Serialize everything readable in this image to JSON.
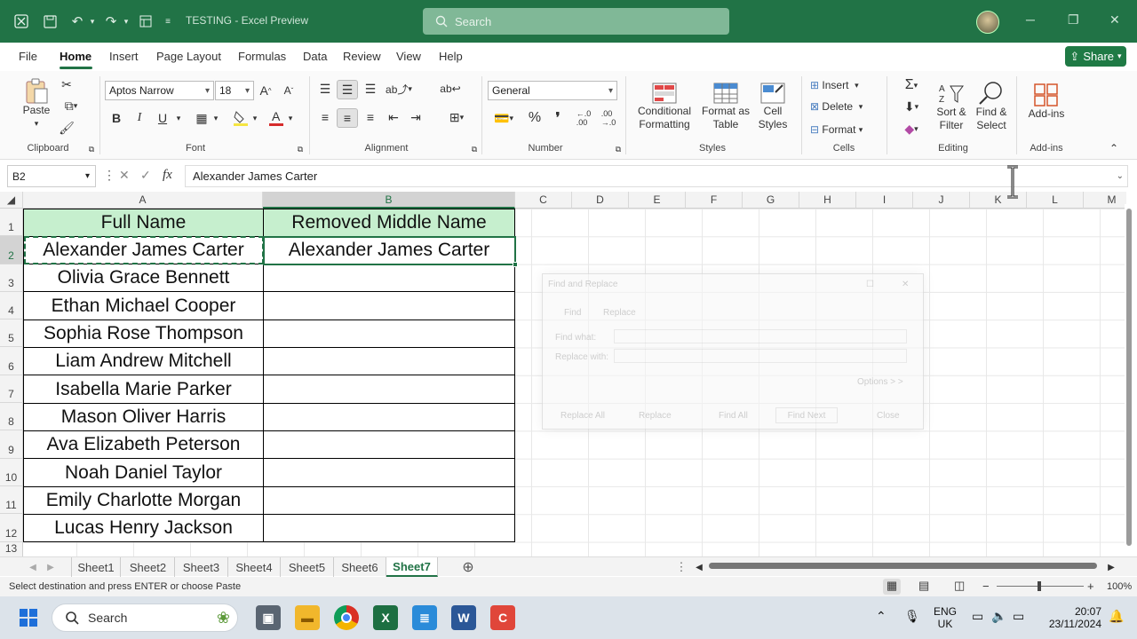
{
  "titlebar": {
    "title": "TESTING  -  Excel Preview",
    "search_placeholder": "Search"
  },
  "menu": {
    "items": [
      "File",
      "Home",
      "Insert",
      "Page Layout",
      "Formulas",
      "Data",
      "Review",
      "View",
      "Help"
    ],
    "active": "Home",
    "share_label": "Share"
  },
  "ribbon": {
    "clipboard": {
      "paste": "Paste",
      "label": "Clipboard"
    },
    "font": {
      "name": "Aptos Narrow",
      "size": "18",
      "label": "Font",
      "bold": "B",
      "italic": "I",
      "underline": "U"
    },
    "alignment": {
      "label": "Alignment"
    },
    "number": {
      "format": "General",
      "label": "Number"
    },
    "styles": {
      "conditional": "Conditional Formatting",
      "format_table": "Format as Table",
      "cell_styles": "Cell Styles",
      "label": "Styles"
    },
    "cells": {
      "insert": "Insert",
      "delete": "Delete",
      "format": "Format",
      "label": "Cells"
    },
    "editing": {
      "sort": "Sort & Filter",
      "find": "Find & Select",
      "label": "Editing"
    },
    "addins": {
      "button": "Add-ins",
      "label": "Add-ins"
    }
  },
  "formula_bar": {
    "name_box": "B2",
    "content": "Alexander James Carter"
  },
  "grid": {
    "columns": [
      "A",
      "B",
      "C",
      "D",
      "E",
      "F",
      "G",
      "H",
      "I",
      "J",
      "K",
      "L",
      "M"
    ],
    "rows": [
      "1",
      "2",
      "3",
      "4",
      "5",
      "6",
      "7",
      "8",
      "9",
      "10",
      "11",
      "12",
      "13"
    ],
    "header_a": "Full Name",
    "header_b": "Removed Middle Name",
    "names": [
      "Alexander James Carter",
      "Olivia Grace Bennett",
      "Ethan Michael Cooper",
      "Sophia Rose Thompson",
      "Liam Andrew Mitchell",
      "Isabella Marie Parker",
      "Mason Oliver Harris",
      "Ava Elizabeth Peterson",
      "Noah Daniel Taylor",
      "Emily Charlotte Morgan",
      "Lucas Henry Jackson"
    ],
    "b2_value": "Alexander James Carter",
    "header_fill": "#c6efce"
  },
  "dialog": {
    "title": "Find and Replace",
    "tabs": [
      "Find",
      "Replace"
    ],
    "find_label": "Find what:",
    "replace_label": "Replace with:",
    "options": "Options > >",
    "buttons": [
      "Replace All",
      "Replace",
      "Find All",
      "Find Next",
      "Close"
    ]
  },
  "sheets": {
    "tabs": [
      "Sheet1",
      "Sheet2",
      "Sheet3",
      "Sheet4",
      "Sheet5",
      "Sheet6",
      "Sheet7"
    ],
    "active": "Sheet7"
  },
  "status": {
    "message": "Select destination and press ENTER or choose Paste",
    "zoom": "100%"
  },
  "taskbar": {
    "search": "Search",
    "lang_top": "ENG",
    "lang_bottom": "UK",
    "time": "20:07",
    "date": "23/11/2024"
  },
  "colors": {
    "accent": "#217346",
    "header_fill": "#c6efce"
  }
}
